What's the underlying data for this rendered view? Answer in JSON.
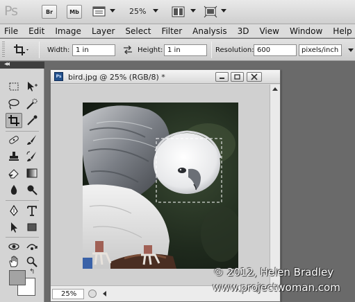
{
  "app": {
    "logo": "Ps",
    "bridge_label": "Br",
    "minibridge_label": "Mb",
    "zoom": "25%"
  },
  "menu": [
    "File",
    "Edit",
    "Image",
    "Layer",
    "Select",
    "Filter",
    "Analysis",
    "3D",
    "View",
    "Window",
    "Help"
  ],
  "options": {
    "width_label": "Width:",
    "width_value": "1 in",
    "height_label": "Height:",
    "height_value": "1 in",
    "resolution_label": "Resolution:",
    "resolution_value": "600",
    "resolution_unit": "pixels/inch"
  },
  "toolbox": {
    "collapse": "◂◂",
    "active_tool": "crop",
    "foreground_color": "#a3a3a3",
    "background_color": "#ffffff"
  },
  "document": {
    "title": "bird.jpg @ 25% (RGB/8) *",
    "status_zoom": "25%"
  },
  "watermark": {
    "line1": "© 2012, Helen Bradley",
    "line2": "www.projectwoman.com"
  },
  "colors": {
    "workspace": "#6a6a6a",
    "doc_icon": "#22508c"
  }
}
